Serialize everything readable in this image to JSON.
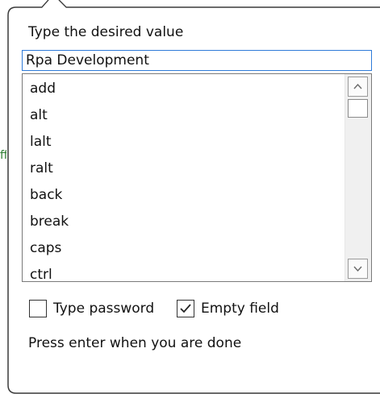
{
  "popup": {
    "prompt": "Type the desired value",
    "input_value": "Rpa Development",
    "hint": "Press enter when you are done"
  },
  "list": {
    "items": [
      "add",
      "alt",
      "lalt",
      "ralt",
      "back",
      "break",
      "caps",
      "ctrl"
    ]
  },
  "options": {
    "type_password": {
      "label": "Type password",
      "checked": false
    },
    "empty_field": {
      "label": "Empty field",
      "checked": true
    }
  },
  "background": {
    "fragment": "ff"
  },
  "colors": {
    "input_focus_border": "#2f7bd9",
    "popup_border": "#3a3a3a",
    "scrollbar_track": "#f0f0f0"
  },
  "icons": {
    "scroll_up": "triangle-up-icon",
    "scroll_down": "triangle-down-icon",
    "checkmark": "checkmark-icon"
  }
}
